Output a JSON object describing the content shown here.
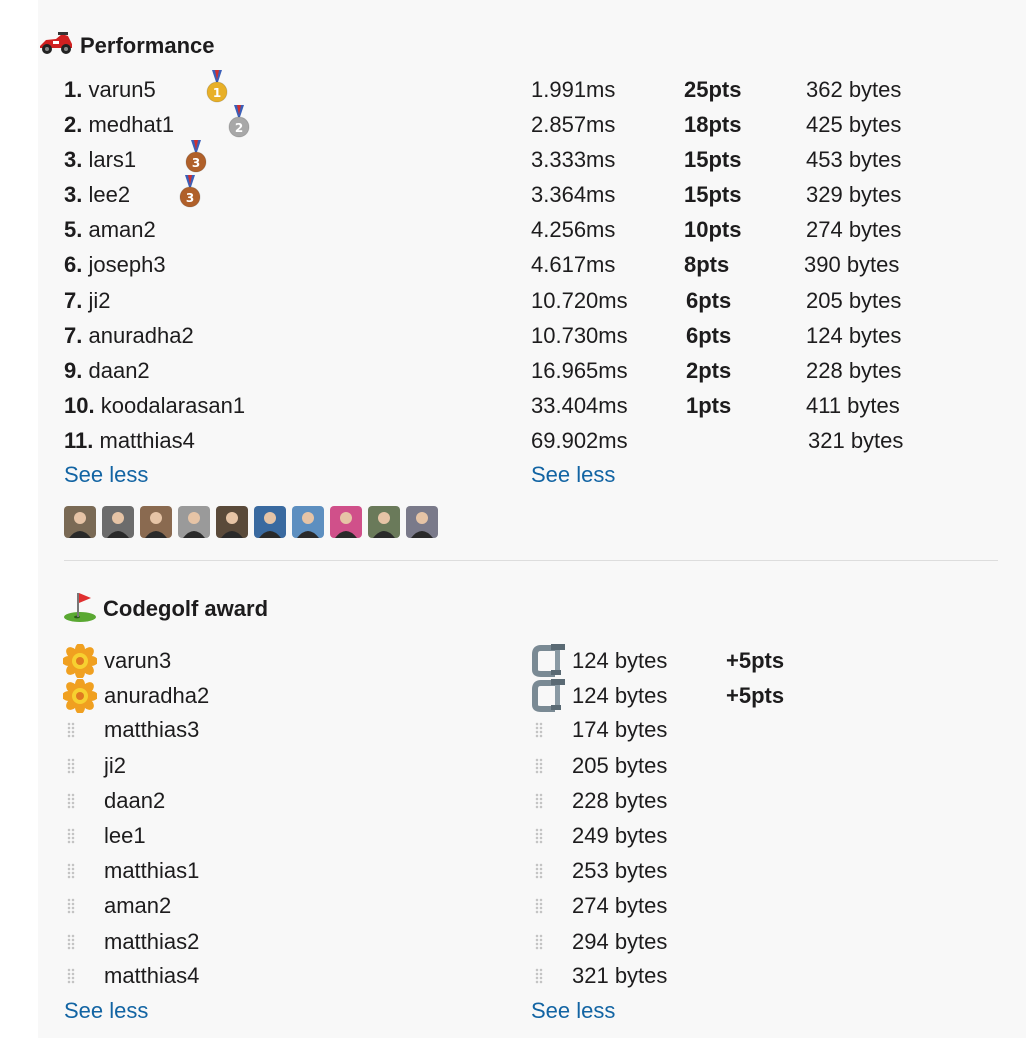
{
  "performance": {
    "title": "Performance",
    "icon": "race-car-icon",
    "rows": [
      {
        "rank": "1.",
        "name": "varun5",
        "time": "1.991ms",
        "pts": "25pts",
        "bytes": "362 bytes",
        "medal": "gold-medal-icon"
      },
      {
        "rank": "2.",
        "name": "medhat1",
        "time": "2.857ms",
        "pts": "18pts",
        "bytes": "425 bytes",
        "medal": "silver-medal-icon"
      },
      {
        "rank": "3.",
        "name": "lars1",
        "time": "3.333ms",
        "pts": "15pts",
        "bytes": "453 bytes",
        "medal": "bronze-medal-icon"
      },
      {
        "rank": "3.",
        "name": "lee2",
        "time": "3.364ms",
        "pts": "15pts",
        "bytes": "329 bytes",
        "medal": "bronze-medal-icon"
      },
      {
        "rank": "5.",
        "name": "aman2",
        "time": "4.256ms",
        "pts": "10pts",
        "bytes": "274 bytes"
      },
      {
        "rank": "6.",
        "name": "joseph3",
        "time": "4.617ms",
        "pts": "8pts",
        "bytes": "390 bytes"
      },
      {
        "rank": "7.",
        "name": "ji2",
        "time": "10.720ms",
        "pts": "6pts",
        "bytes": "205 bytes"
      },
      {
        "rank": "7.",
        "name": "anuradha2",
        "time": "10.730ms",
        "pts": "6pts",
        "bytes": "124 bytes"
      },
      {
        "rank": "9.",
        "name": "daan2",
        "time": "16.965ms",
        "pts": "2pts",
        "bytes": "228 bytes"
      },
      {
        "rank": "10.",
        "name": "koodalarasan1",
        "time": "33.404ms",
        "pts": "1pts",
        "bytes": "411 bytes"
      },
      {
        "rank": "11.",
        "name": "matthias4",
        "time": "69.902ms",
        "pts": "",
        "bytes": "321 bytes"
      }
    ],
    "see_less_left": "See less",
    "see_less_right": "See less",
    "avatar_colors": [
      "#7a6a55",
      "#6c6c6c",
      "#8a6a50",
      "#9a9a9a",
      "#5a4a3a",
      "#3a6aa0",
      "#5d8fc0",
      "#d0508a",
      "#6a7a5a",
      "#7a7a8a"
    ]
  },
  "codegolf": {
    "title": "Codegolf award",
    "icon": "golf-flag-icon",
    "rows": [
      {
        "name": "varun3",
        "bytes": "124 bytes",
        "pts": "+5pts",
        "icon": "rosette-icon",
        "bytes_icon": "clamp-icon"
      },
      {
        "name": "anuradha2",
        "bytes": "124 bytes",
        "pts": "+5pts",
        "icon": "rosette-icon",
        "bytes_icon": "clamp-icon"
      },
      {
        "name": "matthias3",
        "bytes": "174 bytes",
        "pts": "",
        "icon": "drag-handle-icon",
        "bytes_icon": "drag-handle-icon"
      },
      {
        "name": "ji2",
        "bytes": "205 bytes",
        "pts": "",
        "icon": "drag-handle-icon",
        "bytes_icon": "drag-handle-icon"
      },
      {
        "name": "daan2",
        "bytes": "228 bytes",
        "pts": "",
        "icon": "drag-handle-icon",
        "bytes_icon": "drag-handle-icon"
      },
      {
        "name": "lee1",
        "bytes": "249 bytes",
        "pts": "",
        "icon": "drag-handle-icon",
        "bytes_icon": "drag-handle-icon"
      },
      {
        "name": "matthias1",
        "bytes": "253 bytes",
        "pts": "",
        "icon": "drag-handle-icon",
        "bytes_icon": "drag-handle-icon"
      },
      {
        "name": "aman2",
        "bytes": "274 bytes",
        "pts": "",
        "icon": "drag-handle-icon",
        "bytes_icon": "drag-handle-icon"
      },
      {
        "name": "matthias2",
        "bytes": "294 bytes",
        "pts": "",
        "icon": "drag-handle-icon",
        "bytes_icon": "drag-handle-icon"
      },
      {
        "name": "matthias4",
        "bytes": "321 bytes",
        "pts": "",
        "icon": "drag-handle-icon",
        "bytes_icon": "drag-handle-icon"
      }
    ],
    "see_less_left": "See less",
    "see_less_right": "See less"
  },
  "colors": {
    "link": "#1264a3",
    "gold": "#e8b028",
    "silver": "#a8a8a8",
    "bronze": "#b0602a"
  }
}
